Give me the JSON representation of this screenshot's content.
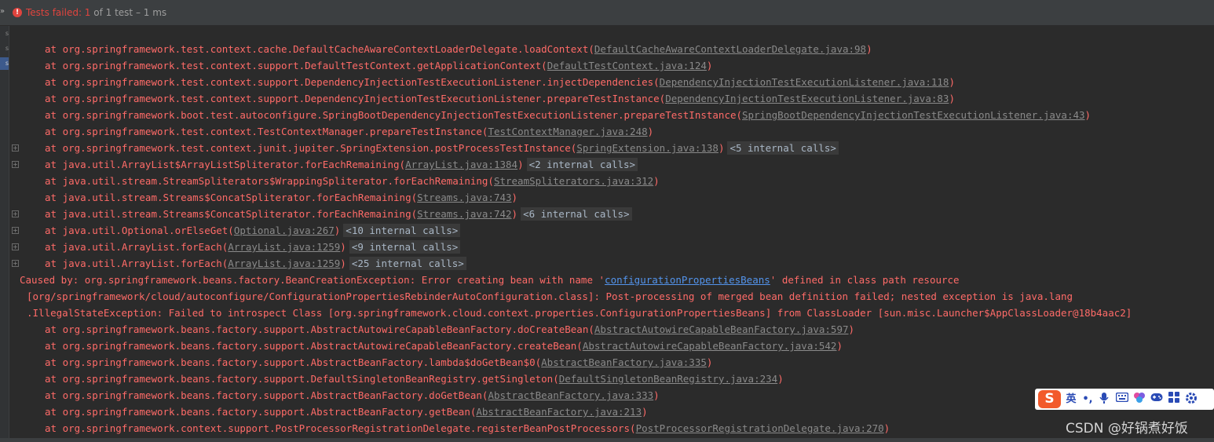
{
  "status": {
    "failed_label": "Tests failed: 1",
    "summary": " of 1 test – 1 ms"
  },
  "left_tabs": [
    "s",
    "s",
    "s"
  ],
  "stack": [
    {
      "prefix": "at org.springframework.test.context.cache.DefaultCacheAwareContextLoaderDelegate.loadContext(",
      "link": "DefaultCacheAwareContextLoaderDelegate.java:98",
      "suffix": ")",
      "internal": "",
      "expandable": false
    },
    {
      "prefix": "at org.springframework.test.context.support.DefaultTestContext.getApplicationContext(",
      "link": "DefaultTestContext.java:124",
      "suffix": ")",
      "internal": "",
      "expandable": false
    },
    {
      "prefix": "at org.springframework.test.context.support.DependencyInjectionTestExecutionListener.injectDependencies(",
      "link": "DependencyInjectionTestExecutionListener.java:118",
      "suffix": ")",
      "internal": "",
      "expandable": false
    },
    {
      "prefix": "at org.springframework.test.context.support.DependencyInjectionTestExecutionListener.prepareTestInstance(",
      "link": "DependencyInjectionTestExecutionListener.java:83",
      "suffix": ")",
      "internal": "",
      "expandable": false
    },
    {
      "prefix": "at org.springframework.boot.test.autoconfigure.SpringBootDependencyInjectionTestExecutionListener.prepareTestInstance(",
      "link": "SpringBootDependencyInjectionTestExecutionListener.java:43",
      "suffix": ")",
      "internal": "",
      "expandable": false
    },
    {
      "prefix": "at org.springframework.test.context.TestContextManager.prepareTestInstance(",
      "link": "TestContextManager.java:248",
      "suffix": ")",
      "internal": "",
      "expandable": false
    },
    {
      "prefix": "at org.springframework.test.context.junit.jupiter.SpringExtension.postProcessTestInstance(",
      "link": "SpringExtension.java:138",
      "suffix": ")",
      "internal": "<5 internal calls>",
      "expandable": true
    },
    {
      "prefix": "at java.util.ArrayList$ArrayListSpliterator.forEachRemaining(",
      "link": "ArrayList.java:1384",
      "suffix": ")",
      "internal": "<2 internal calls>",
      "expandable": true
    },
    {
      "prefix": "at java.util.stream.StreamSpliterators$WrappingSpliterator.forEachRemaining(",
      "link": "StreamSpliterators.java:312",
      "suffix": ")",
      "internal": "",
      "expandable": false
    },
    {
      "prefix": "at java.util.stream.Streams$ConcatSpliterator.forEachRemaining(",
      "link": "Streams.java:743",
      "suffix": ")",
      "internal": "",
      "expandable": false
    },
    {
      "prefix": "at java.util.stream.Streams$ConcatSpliterator.forEachRemaining(",
      "link": "Streams.java:742",
      "suffix": ")",
      "internal": "<6 internal calls>",
      "expandable": true
    },
    {
      "prefix": "at java.util.Optional.orElseGet(",
      "link": "Optional.java:267",
      "suffix": ")",
      "internal": "<10 internal calls>",
      "expandable": true
    },
    {
      "prefix": "at java.util.ArrayList.forEach(",
      "link": "ArrayList.java:1259",
      "suffix": ")",
      "internal": "<9 internal calls>",
      "expandable": true
    },
    {
      "prefix": "at java.util.ArrayList.forEach(",
      "link": "ArrayList.java:1259",
      "suffix": ")",
      "internal": "<25 internal calls>",
      "expandable": true
    }
  ],
  "caused_by": {
    "line1_prefix": "Caused by: org.springframework.beans.factory.BeanCreationException: Error creating bean with name '",
    "line1_link": "configurationPropertiesBeans",
    "line1_suffix": "' defined in class path resource",
    "line2": "[org/springframework/cloud/autoconfigure/ConfigurationPropertiesRebinderAutoConfiguration.class]: Post-processing of merged bean definition failed; nested exception is java.lang",
    "line3": ".IllegalStateException: Failed to introspect Class [org.springframework.cloud.context.properties.ConfigurationPropertiesBeans] from ClassLoader [sun.misc.Launcher$AppClassLoader@18b4aac2]"
  },
  "stack2": [
    {
      "prefix": "at org.springframework.beans.factory.support.AbstractAutowireCapableBeanFactory.doCreateBean(",
      "link": "AbstractAutowireCapableBeanFactory.java:597",
      "suffix": ")"
    },
    {
      "prefix": "at org.springframework.beans.factory.support.AbstractAutowireCapableBeanFactory.createBean(",
      "link": "AbstractAutowireCapableBeanFactory.java:542",
      "suffix": ")"
    },
    {
      "prefix": "at org.springframework.beans.factory.support.AbstractBeanFactory.lambda$doGetBean$0(",
      "link": "AbstractBeanFactory.java:335",
      "suffix": ")"
    },
    {
      "prefix": "at org.springframework.beans.factory.support.DefaultSingletonBeanRegistry.getSingleton(",
      "link": "DefaultSingletonBeanRegistry.java:234",
      "suffix": ")"
    },
    {
      "prefix": "at org.springframework.beans.factory.support.AbstractBeanFactory.doGetBean(",
      "link": "AbstractBeanFactory.java:333",
      "suffix": ")"
    },
    {
      "prefix": "at org.springframework.beans.factory.support.AbstractBeanFactory.getBean(",
      "link": "AbstractBeanFactory.java:213",
      "suffix": ")"
    },
    {
      "prefix": "at org.springframework.context.support.PostProcessorRegistrationDelegate.registerBeanPostProcessors(",
      "link": "PostProcessorRegistrationDelegate.java:270",
      "suffix": ")"
    }
  ],
  "ime": {
    "logo": "S",
    "lang": "英",
    "items": [
      "•,",
      "mic-icon",
      "keyboard-icon",
      "skin-icon",
      "gamepad-icon",
      "grid-icon",
      "settings-icon"
    ]
  },
  "watermark": "CSDN @好锅煮好饭",
  "colors": {
    "error": "#ff6b68",
    "link": "#8a8a8a",
    "blue_link": "#5394ec",
    "background": "#2b2b2b"
  }
}
